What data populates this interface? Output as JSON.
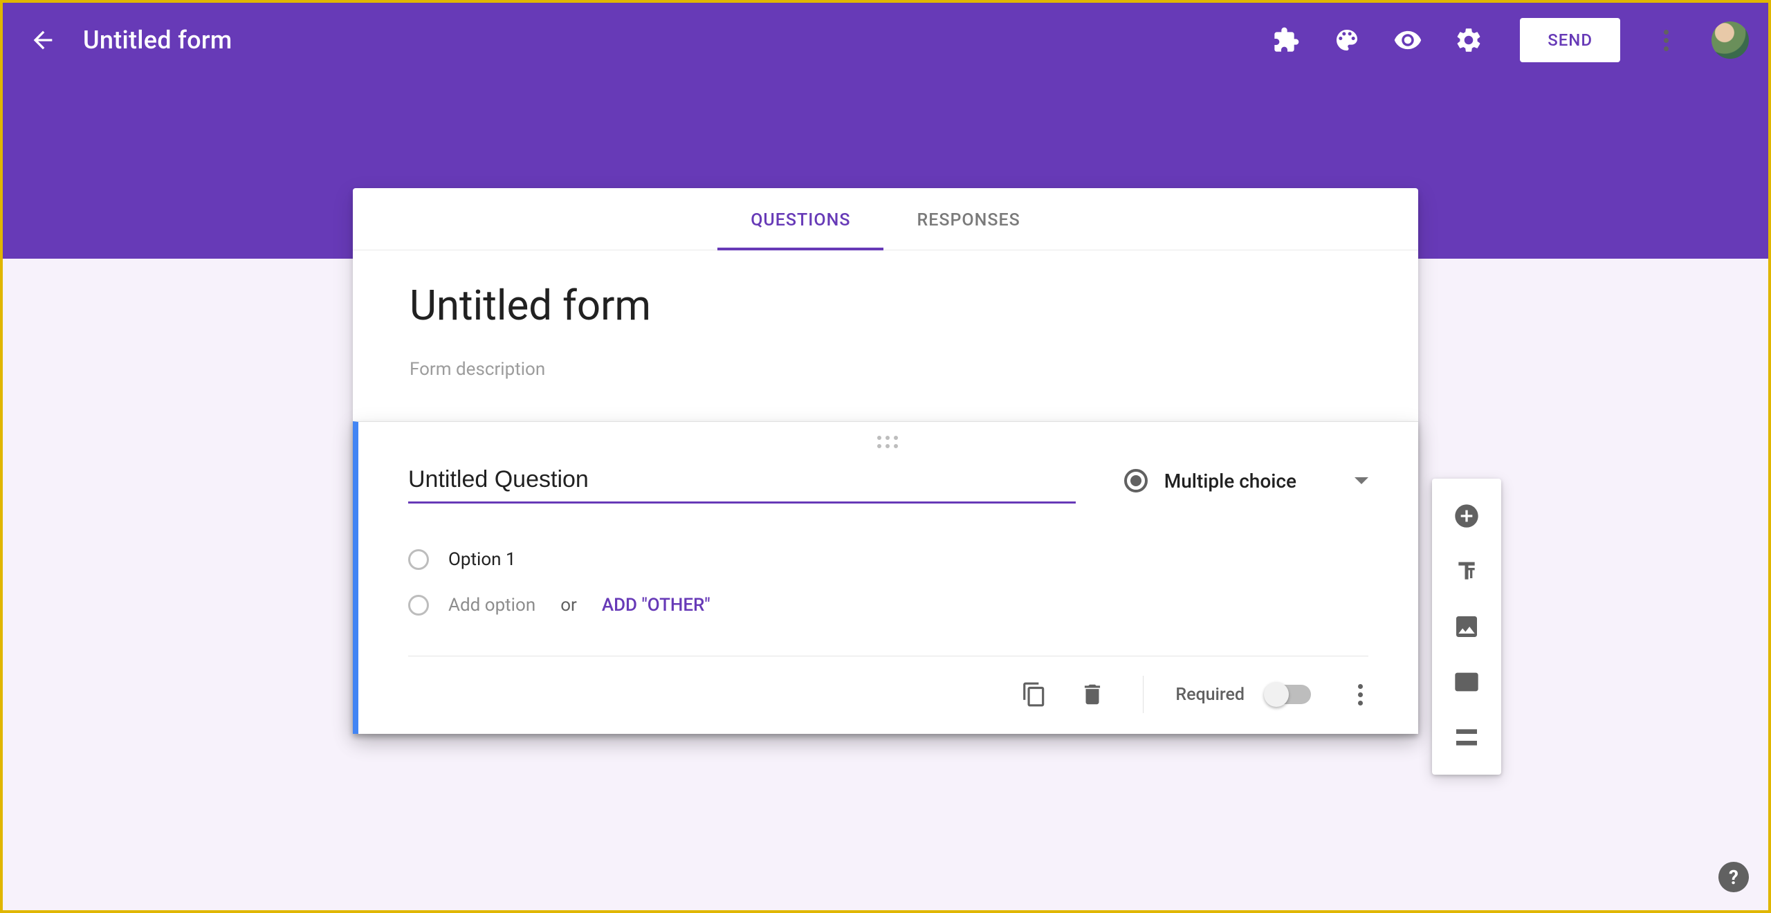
{
  "header": {
    "title": "Untitled form",
    "send_label": "SEND"
  },
  "tabs": {
    "questions": "QUESTIONS",
    "responses": "RESPONSES"
  },
  "form": {
    "title": "Untitled form",
    "description_placeholder": "Form description"
  },
  "question": {
    "title": "Untitled Question",
    "type_label": "Multiple choice",
    "options": [
      {
        "label": "Option 1"
      }
    ],
    "add_option_placeholder": "Add option",
    "or_label": "or",
    "add_other_label": "ADD \"OTHER\"",
    "required_label": "Required"
  },
  "help_label": "?"
}
